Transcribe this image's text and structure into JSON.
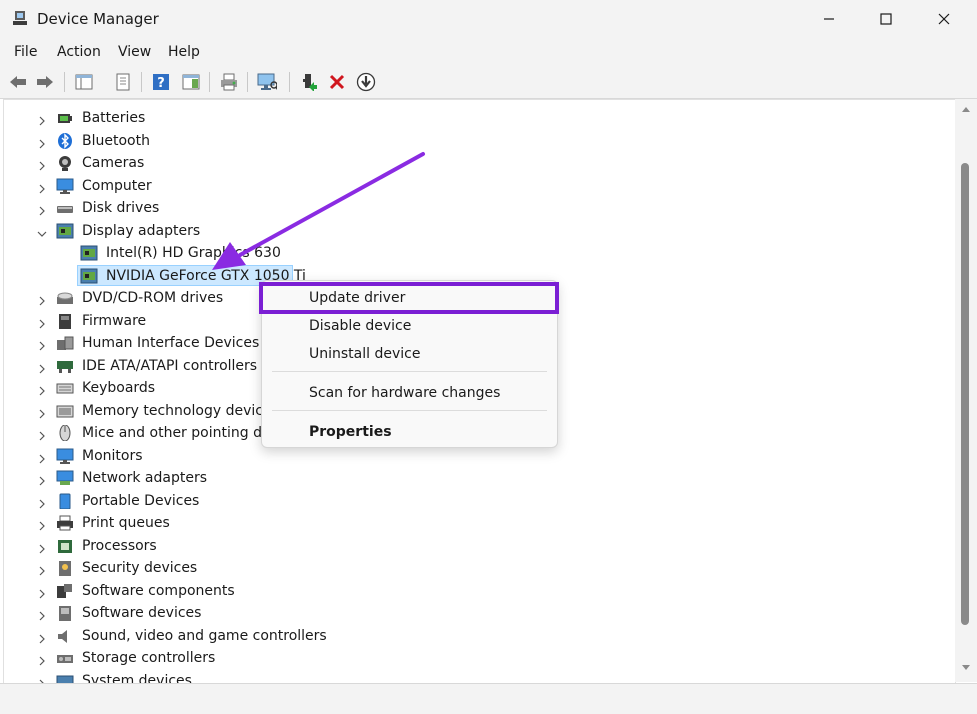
{
  "window": {
    "title": "Device Manager",
    "app_icon": "device-manager-icon"
  },
  "window_controls": {
    "minimize_icon": "minimize-icon",
    "maximize_icon": "maximize-icon",
    "close_icon": "close-icon"
  },
  "menu": {
    "items": [
      "File",
      "Action",
      "View",
      "Help"
    ]
  },
  "toolbar": {
    "buttons": [
      "back-icon",
      "forward-icon",
      "show-hide-console-tree-icon",
      "properties-icon",
      "help-icon",
      "action-pane-icon",
      "print-icon",
      "scan-hardware-icon",
      "enable-device-icon",
      "uninstall-device-icon",
      "update-driver-icon"
    ]
  },
  "tree": {
    "items": [
      {
        "label": "Batteries",
        "icon": "battery-icon",
        "expanded": false
      },
      {
        "label": "Bluetooth",
        "icon": "bluetooth-icon",
        "expanded": false
      },
      {
        "label": "Cameras",
        "icon": "camera-icon",
        "expanded": false
      },
      {
        "label": "Computer",
        "icon": "computer-icon",
        "expanded": false
      },
      {
        "label": "Disk drives",
        "icon": "disk-drive-icon",
        "expanded": false
      },
      {
        "label": "Display adapters",
        "icon": "display-adapter-icon",
        "expanded": true
      },
      {
        "label": "Intel(R) HD Graphics 630",
        "icon": "display-adapter-icon",
        "child": true
      },
      {
        "label": "NVIDIA GeForce GTX 1050 Ti",
        "icon": "display-adapter-icon",
        "child": true,
        "selected": true
      },
      {
        "label": "DVD/CD-ROM drives",
        "icon": "dvd-drive-icon",
        "expanded": false
      },
      {
        "label": "Firmware",
        "icon": "firmware-icon",
        "expanded": false
      },
      {
        "label": "Human Interface Devices",
        "icon": "hid-icon",
        "expanded": false
      },
      {
        "label": "IDE ATA/ATAPI controllers",
        "icon": "ide-controller-icon",
        "expanded": false
      },
      {
        "label": "Keyboards",
        "icon": "keyboard-icon",
        "expanded": false
      },
      {
        "label": "Memory technology devices",
        "icon": "memory-device-icon",
        "expanded": false
      },
      {
        "label": "Mice and other pointing devices",
        "icon": "mouse-icon",
        "expanded": false
      },
      {
        "label": "Monitors",
        "icon": "monitor-icon",
        "expanded": false
      },
      {
        "label": "Network adapters",
        "icon": "network-adapter-icon",
        "expanded": false
      },
      {
        "label": "Portable Devices",
        "icon": "portable-device-icon",
        "expanded": false
      },
      {
        "label": "Print queues",
        "icon": "printer-icon",
        "expanded": false
      },
      {
        "label": "Processors",
        "icon": "processor-icon",
        "expanded": false
      },
      {
        "label": "Security devices",
        "icon": "security-device-icon",
        "expanded": false
      },
      {
        "label": "Software components",
        "icon": "software-component-icon",
        "expanded": false
      },
      {
        "label": "Software devices",
        "icon": "software-device-icon",
        "expanded": false
      },
      {
        "label": "Sound, video and game controllers",
        "icon": "sound-icon",
        "expanded": false
      },
      {
        "label": "Storage controllers",
        "icon": "storage-controller-icon",
        "expanded": false
      },
      {
        "label": "System devices",
        "icon": "system-device-icon",
        "expanded": false
      }
    ]
  },
  "context_menu": {
    "update_driver": "Update driver",
    "disable_device": "Disable device",
    "uninstall_device": "Uninstall device",
    "scan_hardware": "Scan for hardware changes",
    "properties": "Properties"
  },
  "colors": {
    "highlight_box": "#7b1fd4",
    "annotation_arrow": "#8a2be2",
    "selection_bg": "#cce8ff"
  }
}
